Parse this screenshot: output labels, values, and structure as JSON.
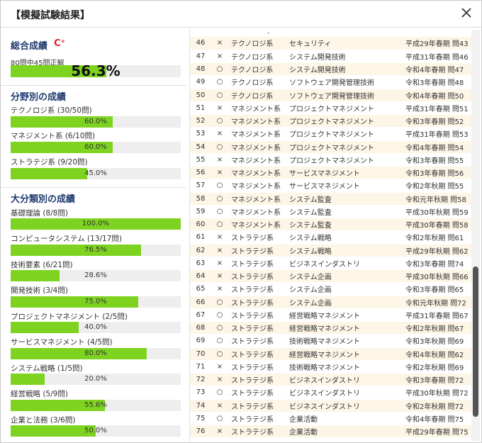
{
  "dialog": {
    "title": "【模擬試験結果】"
  },
  "overall": {
    "title": "総合成績",
    "grade": "C⁺",
    "correct_text": "80問中45問正解",
    "percent": 56.3,
    "percent_label": "56.3%"
  },
  "field": {
    "title": "分野別の成績",
    "items": [
      {
        "label": "テクノロジ系 (30/50問)",
        "percent": 60.0,
        "percent_label": "60.0%"
      },
      {
        "label": "マネジメント系 (6/10問)",
        "percent": 60.0,
        "percent_label": "60.0%"
      },
      {
        "label": "ストラテジ系 (9/20問)",
        "percent": 45.0,
        "percent_label": "45.0%"
      }
    ]
  },
  "category": {
    "title": "大分類別の成績",
    "items": [
      {
        "label": "基礎理論 (8/8問)",
        "percent": 100.0,
        "percent_label": "100.0%"
      },
      {
        "label": "コンピュータシステム (13/17問)",
        "percent": 76.5,
        "percent_label": "76.5%"
      },
      {
        "label": "技術要素 (6/21問)",
        "percent": 28.6,
        "percent_label": "28.6%"
      },
      {
        "label": "開発技術 (3/4問)",
        "percent": 75.0,
        "percent_label": "75.0%"
      },
      {
        "label": "プロジェクトマネジメント (2/5問)",
        "percent": 40.0,
        "percent_label": "40.0%"
      },
      {
        "label": "サービスマネジメント (4/5問)",
        "percent": 80.0,
        "percent_label": "80.0%"
      },
      {
        "label": "システム戦略 (1/5問)",
        "percent": 20.0,
        "percent_label": "20.0%"
      },
      {
        "label": "経営戦略 (5/9問)",
        "percent": 55.6,
        "percent_label": "55.6%"
      },
      {
        "label": "企業と法務 (3/6問)",
        "percent": 50.0,
        "percent_label": "50.0%"
      }
    ]
  },
  "table": {
    "top_mark": "・",
    "rows": [
      {
        "no": "46",
        "mark": "×",
        "field": "テクノロジ系",
        "sub": "セキュリティ",
        "ref": "平成29年春期 問43"
      },
      {
        "no": "47",
        "mark": "×",
        "field": "テクノロジ系",
        "sub": "システム開発技術",
        "ref": "平成31年春期 問46"
      },
      {
        "no": "48",
        "mark": "○",
        "field": "テクノロジ系",
        "sub": "システム開発技術",
        "ref": "令和4年春期 問47"
      },
      {
        "no": "49",
        "mark": "○",
        "field": "テクノロジ系",
        "sub": "ソフトウェア開発管理技術",
        "ref": "令和3年春期 問48"
      },
      {
        "no": "50",
        "mark": "○",
        "field": "テクノロジ系",
        "sub": "ソフトウェア開発管理技術",
        "ref": "令和4年春期 問50"
      },
      {
        "no": "51",
        "mark": "×",
        "field": "マネジメント系",
        "sub": "プロジェクトマネジメント",
        "ref": "平成31年春期 問51"
      },
      {
        "no": "52",
        "mark": "○",
        "field": "マネジメント系",
        "sub": "プロジェクトマネジメント",
        "ref": "令和3年春期 問52"
      },
      {
        "no": "53",
        "mark": "×",
        "field": "マネジメント系",
        "sub": "プロジェクトマネジメント",
        "ref": "平成31年春期 問53"
      },
      {
        "no": "54",
        "mark": "○",
        "field": "マネジメント系",
        "sub": "プロジェクトマネジメント",
        "ref": "令和4年春期 問54"
      },
      {
        "no": "55",
        "mark": "×",
        "field": "マネジメント系",
        "sub": "プロジェクトマネジメント",
        "ref": "令和3年春期 問55"
      },
      {
        "no": "56",
        "mark": "×",
        "field": "マネジメント系",
        "sub": "サービスマネジメント",
        "ref": "令和3年春期 問56"
      },
      {
        "no": "57",
        "mark": "○",
        "field": "マネジメント系",
        "sub": "サービスマネジメント",
        "ref": "令和2年秋期 問55"
      },
      {
        "no": "58",
        "mark": "○",
        "field": "マネジメント系",
        "sub": "システム監査",
        "ref": "令和元年秋期 問58"
      },
      {
        "no": "59",
        "mark": "○",
        "field": "マネジメント系",
        "sub": "システム監査",
        "ref": "平成30年秋期 問59"
      },
      {
        "no": "60",
        "mark": "○",
        "field": "マネジメント系",
        "sub": "システム監査",
        "ref": "平成30年春期 問58"
      },
      {
        "no": "61",
        "mark": "×",
        "field": "ストラテジ系",
        "sub": "システム戦略",
        "ref": "令和2年秋期 問61"
      },
      {
        "no": "62",
        "mark": "×",
        "field": "ストラテジ系",
        "sub": "システム戦略",
        "ref": "平成29年秋期 問62"
      },
      {
        "no": "63",
        "mark": "×",
        "field": "ストラテジ系",
        "sub": "ビジネスインダストリ",
        "ref": "令和3年春期 問74"
      },
      {
        "no": "64",
        "mark": "×",
        "field": "ストラテジ系",
        "sub": "システム企画",
        "ref": "平成30年秋期 問66"
      },
      {
        "no": "65",
        "mark": "×",
        "field": "ストラテジ系",
        "sub": "システム企画",
        "ref": "令和3年春期 問65"
      },
      {
        "no": "66",
        "mark": "○",
        "field": "ストラテジ系",
        "sub": "システム企画",
        "ref": "令和元年秋期 問72"
      },
      {
        "no": "67",
        "mark": "○",
        "field": "ストラテジ系",
        "sub": "経営戦略マネジメント",
        "ref": "平成31年春期 問67"
      },
      {
        "no": "68",
        "mark": "○",
        "field": "ストラテジ系",
        "sub": "経営戦略マネジメント",
        "ref": "令和2年秋期 問67"
      },
      {
        "no": "69",
        "mark": "○",
        "field": "ストラテジ系",
        "sub": "技術戦略マネジメント",
        "ref": "令和3年秋期 問69"
      },
      {
        "no": "70",
        "mark": "○",
        "field": "ストラテジ系",
        "sub": "経営戦略マネジメント",
        "ref": "令和4年秋期 問62"
      },
      {
        "no": "71",
        "mark": "×",
        "field": "ストラテジ系",
        "sub": "技術戦略マネジメント",
        "ref": "令和2年秋期 問69"
      },
      {
        "no": "72",
        "mark": "×",
        "field": "ストラテジ系",
        "sub": "ビジネスインダストリ",
        "ref": "令和3年春期 問72"
      },
      {
        "no": "73",
        "mark": "○",
        "field": "ストラテジ系",
        "sub": "ビジネスインダストリ",
        "ref": "平成30年秋期 問72"
      },
      {
        "no": "74",
        "mark": "×",
        "field": "ストラテジ系",
        "sub": "ビジネスインダストリ",
        "ref": "令和2年秋期 問72"
      },
      {
        "no": "75",
        "mark": "○",
        "field": "ストラテジ系",
        "sub": "企業活動",
        "ref": "令和4年春期 問75"
      },
      {
        "no": "76",
        "mark": "×",
        "field": "ストラテジ系",
        "sub": "企業活動",
        "ref": "平成29年春期 問75"
      }
    ]
  },
  "colors": {
    "bar_fill": "#7ed321",
    "bar_track": "#eeeeee",
    "heading": "#1f3a6e",
    "grade": "#e02020",
    "row_stripe": "#fdf5e6"
  }
}
